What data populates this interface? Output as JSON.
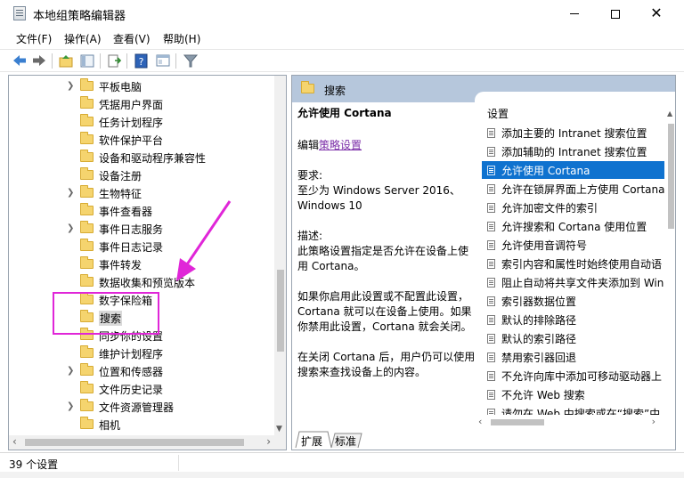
{
  "window": {
    "title": "本地组策略编辑器",
    "minimize_label": "—",
    "maximize_label": "☐",
    "close_label": "✕"
  },
  "menu": {
    "items": [
      "文件(F)",
      "操作(A)",
      "查看(V)",
      "帮助(H)"
    ]
  },
  "toolbar": {
    "icons": [
      "back-icon",
      "forward-icon",
      "up-folder-icon",
      "show-hide-tree-icon",
      "export-list-icon",
      "help-icon",
      "properties-icon",
      "filter-icon"
    ]
  },
  "tree": {
    "items": [
      {
        "label": "平板电脑",
        "expandable": true
      },
      {
        "label": "凭据用户界面",
        "expandable": false
      },
      {
        "label": "任务计划程序",
        "expandable": false
      },
      {
        "label": "软件保护平台",
        "expandable": false
      },
      {
        "label": "设备和驱动程序兼容性",
        "expandable": false
      },
      {
        "label": "设备注册",
        "expandable": false
      },
      {
        "label": "生物特征",
        "expandable": true
      },
      {
        "label": "事件查看器",
        "expandable": false
      },
      {
        "label": "事件日志服务",
        "expandable": true
      },
      {
        "label": "事件日志记录",
        "expandable": false
      },
      {
        "label": "事件转发",
        "expandable": false
      },
      {
        "label": "数据收集和预览版本",
        "expandable": false
      },
      {
        "label": "数字保险箱",
        "expandable": false
      },
      {
        "label": "搜索",
        "expandable": false,
        "selected": true
      },
      {
        "label": "同步你的设置",
        "expandable": false
      },
      {
        "label": "维护计划程序",
        "expandable": false
      },
      {
        "label": "位置和传感器",
        "expandable": true
      },
      {
        "label": "文件历史记录",
        "expandable": false
      },
      {
        "label": "文件资源管理器",
        "expandable": true
      },
      {
        "label": "相机",
        "expandable": false
      }
    ]
  },
  "right_pane": {
    "header_title": "搜索",
    "description": {
      "title": "允许使用 Cortana",
      "edit_prefix": "编辑",
      "edit_link": "策略设置",
      "requirements_label": "要求:",
      "requirements_line1": "至少为 Windows Server 2016、",
      "requirements_line2": "Windows 10",
      "description_label": "描述:",
      "description_line1": "此策略设置指定是否允许在设备上使",
      "description_line2": "用 Cortana。",
      "para2_line1": "如果你启用此设置或不配置此设置，",
      "para2_line2": "Cortana 就可以在设备上使用。如果",
      "para2_line3": "你禁用此设置，Cortana 就会关闭。",
      "para3_line1": "在关闭 Cortana 后，用户仍可以使用",
      "para3_line2": "搜索来查找设备上的内容。"
    },
    "settings_header": "设置",
    "settings": [
      {
        "label": "添加主要的 Intranet 搜索位置"
      },
      {
        "label": "添加辅助的 Intranet 搜索位置"
      },
      {
        "label": "允许使用 Cortana",
        "selected": true
      },
      {
        "label": "允许在锁屏界面上方使用 Cortana"
      },
      {
        "label": "允许加密文件的索引"
      },
      {
        "label": "允许搜索和 Cortana 使用位置"
      },
      {
        "label": "允许使用音调符号"
      },
      {
        "label": "索引内容和属性时始终使用自动语"
      },
      {
        "label": "阻止自动将共享文件夹添加到 Win"
      },
      {
        "label": "索引器数据位置"
      },
      {
        "label": "默认的排除路径"
      },
      {
        "label": "默认的索引路径"
      },
      {
        "label": "禁用索引器回退"
      },
      {
        "label": "不允许向库中添加可移动驱动器上"
      },
      {
        "label": "不允许 Web 搜索"
      },
      {
        "label": "请勿在 Web 中搜索或在“搜索”中"
      }
    ],
    "tabs": [
      "扩展",
      "标准"
    ]
  },
  "status": {
    "text": "39 个设置"
  },
  "colors": {
    "selection_blue": "#0f72cf",
    "header_blue": "#b6c7dc",
    "annotation_magenta": "#e026d8",
    "link_purple": "#7b2ea8"
  }
}
